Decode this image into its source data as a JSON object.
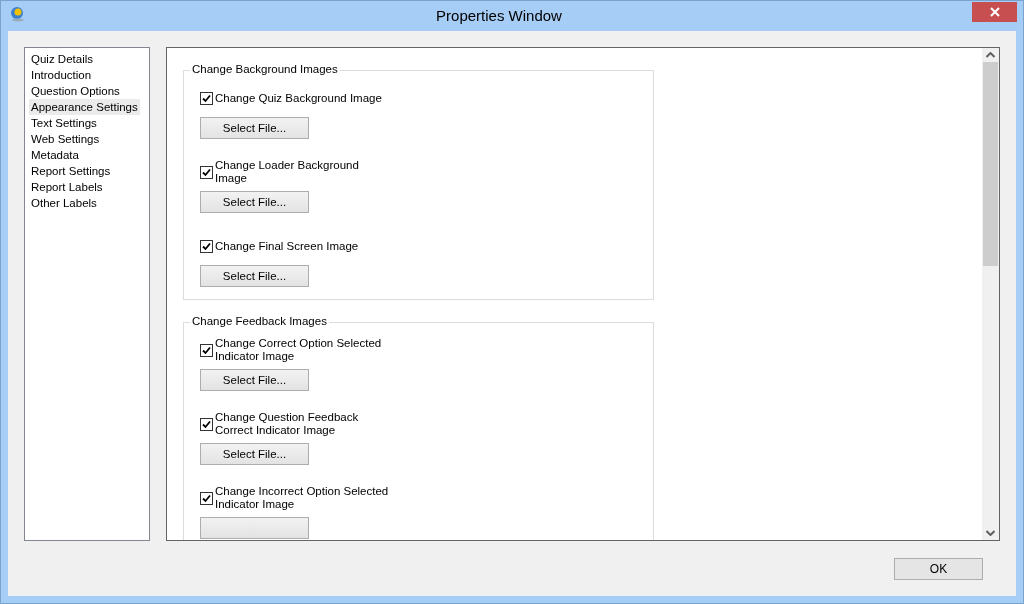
{
  "window": {
    "title": "Properties Window"
  },
  "sidebar": {
    "items": [
      {
        "label": "Quiz Details",
        "selected": false
      },
      {
        "label": "Introduction",
        "selected": false
      },
      {
        "label": "Question Options",
        "selected": false
      },
      {
        "label": "Appearance Settings",
        "selected": true
      },
      {
        "label": "Text Settings",
        "selected": false
      },
      {
        "label": "Web Settings",
        "selected": false
      },
      {
        "label": "Metadata",
        "selected": false
      },
      {
        "label": "Report Settings",
        "selected": false
      },
      {
        "label": "Report Labels",
        "selected": false
      },
      {
        "label": "Other Labels",
        "selected": false
      }
    ]
  },
  "groups": [
    {
      "title": "Change Background Images",
      "items": [
        {
          "label": "Change Quiz Background Image",
          "checked": true,
          "button": "Select File..."
        },
        {
          "label": "Change Loader Background\nImage",
          "checked": true,
          "button": "Select File..."
        },
        {
          "label": "Change Final Screen Image",
          "checked": true,
          "button": "Select File..."
        }
      ]
    },
    {
      "title": "Change Feedback Images",
      "items": [
        {
          "label": "Change Correct Option Selected\nIndicator Image",
          "checked": true,
          "button": "Select File..."
        },
        {
          "label": "Change Question Feedback\nCorrect Indicator Image",
          "checked": true,
          "button": "Select File..."
        },
        {
          "label": "Change Incorrect Option Selected\nIndicator Image",
          "checked": true
        }
      ]
    }
  ],
  "ok_button": "OK"
}
